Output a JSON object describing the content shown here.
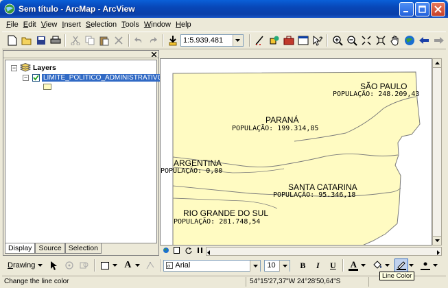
{
  "window": {
    "title": "Sem título - ArcMap - ArcView"
  },
  "menu": [
    {
      "label": "File",
      "key": "F",
      "rest": "ile"
    },
    {
      "label": "Edit",
      "key": "E",
      "rest": "dit"
    },
    {
      "label": "View",
      "key": "V",
      "rest": "iew"
    },
    {
      "label": "Insert",
      "key": "I",
      "rest": "nsert"
    },
    {
      "label": "Selection",
      "key": "S",
      "rest": "election"
    },
    {
      "label": "Tools",
      "key": "T",
      "rest": "ools"
    },
    {
      "label": "Window",
      "key": "W",
      "rest": "indow"
    },
    {
      "label": "Help",
      "key": "H",
      "rest": "elp"
    }
  ],
  "standard_toolbar": {
    "scale": "1:5.939.481"
  },
  "toc": {
    "root_label": "Layers",
    "layer_name": "LIMITE_POLITICO_ADMINISTRATIVO",
    "tabs": [
      "Display",
      "Source",
      "Selection"
    ]
  },
  "map": {
    "fill_color": "#fffbc2",
    "labels": [
      {
        "name": "SÃO PAULO",
        "pop": "POPULAÇÃO: 248.209,43"
      },
      {
        "name": "PARANÁ",
        "pop": "POPULAÇÃO: 199.314,85"
      },
      {
        "name": "ARGENTINA",
        "pop": "POPULAÇÃO: 0,00"
      },
      {
        "name": "SANTA CATARINA",
        "pop": "POPULAÇÃO: 95.346,18"
      },
      {
        "name": "RIO GRANDE DO SUL",
        "pop": "POPULAÇÃO: 281.748,54"
      }
    ]
  },
  "drawing_toolbar": {
    "drawing_label": "Drawing",
    "drawing_key": "D",
    "drawing_rest": "rawing",
    "font": "Arial",
    "font_size": "10",
    "bold": "B",
    "italic": "I",
    "underline": "U",
    "font_color_glyph": "A",
    "text_tool_glyph": "A"
  },
  "tooltip": "Line Color",
  "status": {
    "message": "Change the line color",
    "coordinates": "54°15'27,37\"W  24°28'50,64\"S"
  }
}
